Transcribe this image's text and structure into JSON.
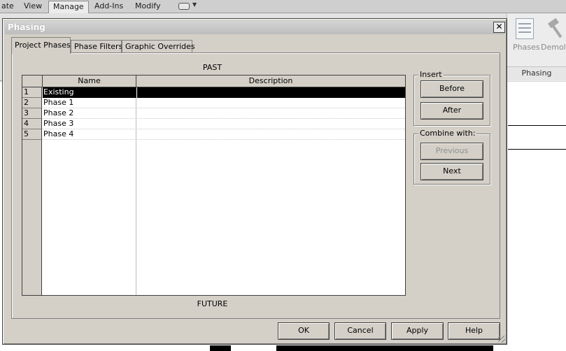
{
  "app": {
    "ribbon_tabs": [
      {
        "label": "ate",
        "active": false
      },
      {
        "label": "View",
        "active": false
      },
      {
        "label": "Manage",
        "active": true
      },
      {
        "label": "Add-Ins",
        "active": false
      },
      {
        "label": "Modify",
        "active": false
      }
    ],
    "ribbon_buttons": {
      "phases_label": "Phases",
      "demolish_label": "Demolis",
      "panel_label": "Phasing"
    }
  },
  "dialog": {
    "title": "Phasing",
    "close_glyph": "✕",
    "tabs": [
      {
        "label": "Project Phases",
        "active": true
      },
      {
        "label": "Phase Filters",
        "active": false
      },
      {
        "label": "Graphic Overrides",
        "active": false
      }
    ],
    "past_label": "PAST",
    "future_label": "FUTURE",
    "table": {
      "columns": [
        "Name",
        "Description"
      ],
      "rows": [
        {
          "num": "1",
          "name": "Existing",
          "description": "",
          "selected": true
        },
        {
          "num": "2",
          "name": "Phase 1",
          "description": "",
          "selected": false
        },
        {
          "num": "3",
          "name": "Phase 2",
          "description": "",
          "selected": false
        },
        {
          "num": "4",
          "name": "Phase 3",
          "description": "",
          "selected": false
        },
        {
          "num": "5",
          "name": "Phase 4",
          "description": "",
          "selected": false
        }
      ]
    },
    "insert": {
      "label": "Insert",
      "before_label": "Before",
      "after_label": "After"
    },
    "combine": {
      "label": "Combine with:",
      "previous_label": "Previous",
      "next_label": "Next",
      "previous_enabled": false
    },
    "footer": {
      "ok_label": "OK",
      "cancel_label": "Cancel",
      "apply_label": "Apply",
      "help_label": "Help"
    }
  }
}
